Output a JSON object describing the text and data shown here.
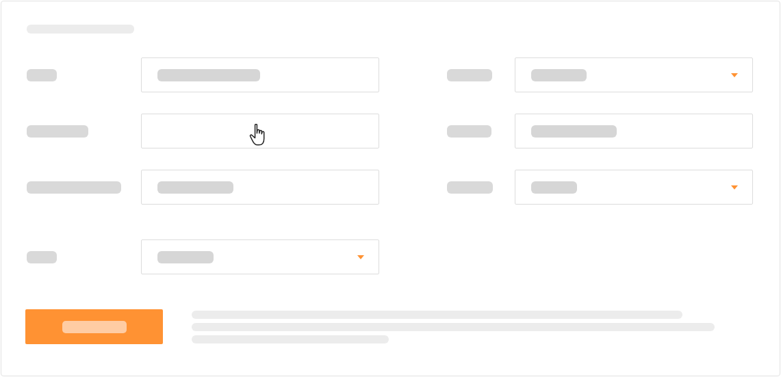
{
  "form": {
    "rows": [
      {
        "left": {
          "kind": "text",
          "filled": true,
          "hovered": false
        },
        "right": {
          "kind": "select",
          "filled": true,
          "hovered": false
        }
      },
      {
        "left": {
          "kind": "text",
          "filled": false,
          "hovered": true
        },
        "right": {
          "kind": "text",
          "filled": true,
          "hovered": false
        }
      },
      {
        "left": {
          "kind": "text",
          "filled": true,
          "hovered": false
        },
        "right": {
          "kind": "select",
          "filled": true,
          "hovered": false
        }
      },
      {
        "left": {
          "kind": "select",
          "filled": true,
          "hovered": false
        }
      }
    ],
    "button": {
      "disabled": false
    }
  }
}
